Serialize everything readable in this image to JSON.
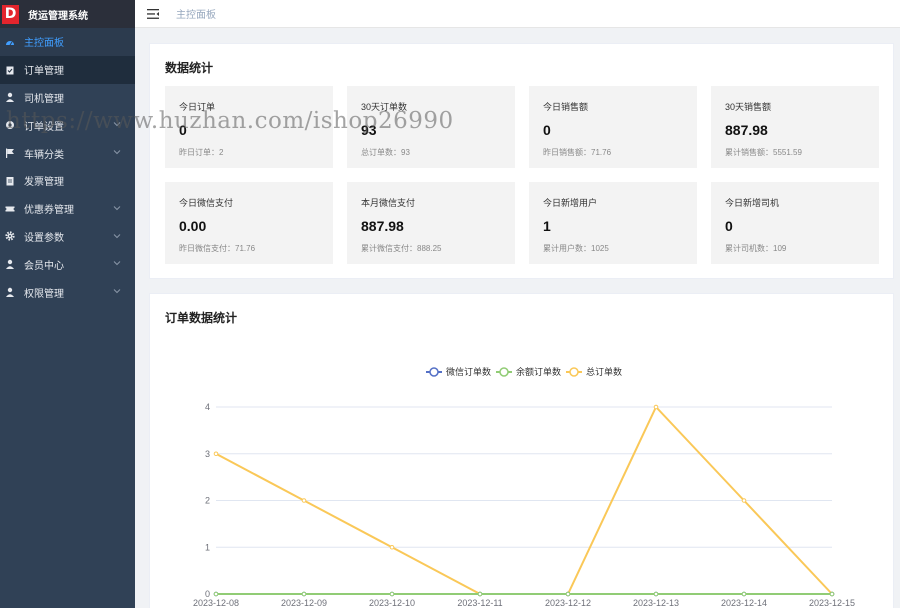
{
  "app": {
    "logo_letter": "D",
    "title": "货运管理系统"
  },
  "sidebar": {
    "items": [
      {
        "label": "主控面板",
        "icon": "dashboard-icon",
        "active": true,
        "expandable": false
      },
      {
        "label": "订单管理",
        "icon": "clipboard-icon",
        "active": false,
        "expandable": false
      },
      {
        "label": "司机管理",
        "icon": "user-icon",
        "active": false,
        "expandable": false
      },
      {
        "label": "订单设置",
        "icon": "settings-circle-icon",
        "active": false,
        "expandable": true
      },
      {
        "label": "车辆分类",
        "icon": "flag-icon",
        "active": false,
        "expandable": true
      },
      {
        "label": "发票管理",
        "icon": "document-icon",
        "active": false,
        "expandable": false
      },
      {
        "label": "优惠券管理",
        "icon": "ticket-icon",
        "active": false,
        "expandable": true
      },
      {
        "label": "设置参数",
        "icon": "gear-icon",
        "active": false,
        "expandable": true
      },
      {
        "label": "会员中心",
        "icon": "user-icon",
        "active": false,
        "expandable": true
      },
      {
        "label": "权限管理",
        "icon": "user-icon",
        "active": false,
        "expandable": true
      }
    ]
  },
  "header": {
    "breadcrumb": "主控面板"
  },
  "stats": {
    "title": "数据统计",
    "cards": [
      {
        "label": "今日订单",
        "value": "0",
        "sub": "昨日订单：2"
      },
      {
        "label": "30天订单数",
        "value": "93",
        "sub": "总订单数：93"
      },
      {
        "label": "今日销售额",
        "value": "0",
        "sub": "昨日销售额：71.76"
      },
      {
        "label": "30天销售额",
        "value": "887.98",
        "sub": "累计销售额：5551.59"
      },
      {
        "label": "今日微信支付",
        "value": "0.00",
        "sub": "昨日微信支付：71.76"
      },
      {
        "label": "本月微信支付",
        "value": "887.98",
        "sub": "累计微信支付：888.25"
      },
      {
        "label": "今日新增用户",
        "value": "1",
        "sub": "累计用户数：1025"
      },
      {
        "label": "今日新增司机",
        "value": "0",
        "sub": "累计司机数：109"
      }
    ]
  },
  "watermark": "https://www.huzhan.com/ishop26990",
  "chart_data": {
    "type": "line",
    "title": "订单数据统计",
    "categories": [
      "2023-12-08",
      "2023-12-09",
      "2023-12-10",
      "2023-12-11",
      "2023-12-12",
      "2023-12-13",
      "2023-12-14",
      "2023-12-15"
    ],
    "series": [
      {
        "name": "微信订单数",
        "color": "#5470c6",
        "values": [
          0,
          0,
          0,
          0,
          0,
          0,
          0,
          0
        ]
      },
      {
        "name": "余额订单数",
        "color": "#91cc75",
        "values": [
          0,
          0,
          0,
          0,
          0,
          0,
          0,
          0
        ]
      },
      {
        "name": "总订单数",
        "color": "#fac858",
        "values": [
          3,
          2,
          1,
          0,
          0,
          4,
          2,
          0
        ]
      }
    ],
    "ylim": [
      0,
      4
    ],
    "yticks": [
      "0",
      "1",
      "2",
      "3",
      "4"
    ],
    "legend": "top-center",
    "grid": true
  }
}
